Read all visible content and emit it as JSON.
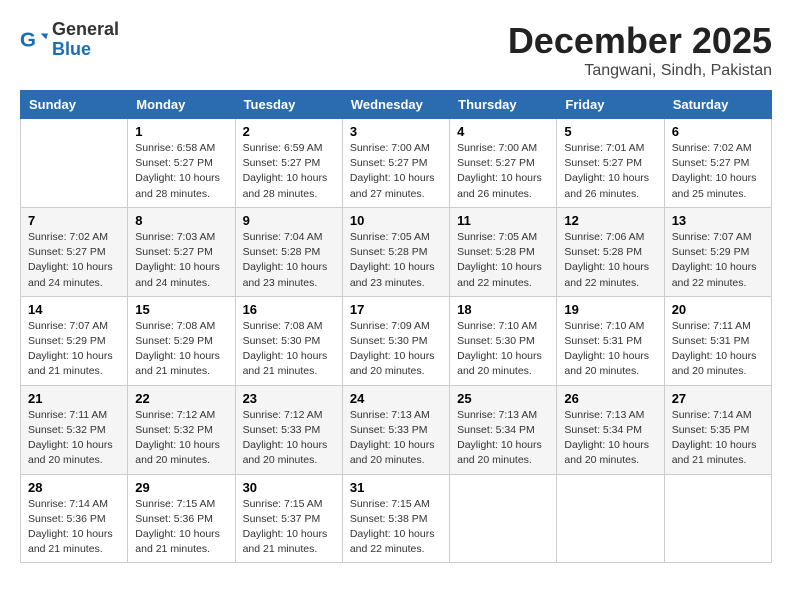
{
  "header": {
    "logo": {
      "general": "General",
      "blue": "Blue"
    },
    "month": "December 2025",
    "location": "Tangwani, Sindh, Pakistan"
  },
  "weekdays": [
    "Sunday",
    "Monday",
    "Tuesday",
    "Wednesday",
    "Thursday",
    "Friday",
    "Saturday"
  ],
  "weeks": [
    [
      {
        "day": "",
        "sunrise": "",
        "sunset": "",
        "daylight": ""
      },
      {
        "day": "1",
        "sunrise": "Sunrise: 6:58 AM",
        "sunset": "Sunset: 5:27 PM",
        "daylight": "Daylight: 10 hours and 28 minutes."
      },
      {
        "day": "2",
        "sunrise": "Sunrise: 6:59 AM",
        "sunset": "Sunset: 5:27 PM",
        "daylight": "Daylight: 10 hours and 28 minutes."
      },
      {
        "day": "3",
        "sunrise": "Sunrise: 7:00 AM",
        "sunset": "Sunset: 5:27 PM",
        "daylight": "Daylight: 10 hours and 27 minutes."
      },
      {
        "day": "4",
        "sunrise": "Sunrise: 7:00 AM",
        "sunset": "Sunset: 5:27 PM",
        "daylight": "Daylight: 10 hours and 26 minutes."
      },
      {
        "day": "5",
        "sunrise": "Sunrise: 7:01 AM",
        "sunset": "Sunset: 5:27 PM",
        "daylight": "Daylight: 10 hours and 26 minutes."
      },
      {
        "day": "6",
        "sunrise": "Sunrise: 7:02 AM",
        "sunset": "Sunset: 5:27 PM",
        "daylight": "Daylight: 10 hours and 25 minutes."
      }
    ],
    [
      {
        "day": "7",
        "sunrise": "Sunrise: 7:02 AM",
        "sunset": "Sunset: 5:27 PM",
        "daylight": "Daylight: 10 hours and 24 minutes."
      },
      {
        "day": "8",
        "sunrise": "Sunrise: 7:03 AM",
        "sunset": "Sunset: 5:27 PM",
        "daylight": "Daylight: 10 hours and 24 minutes."
      },
      {
        "day": "9",
        "sunrise": "Sunrise: 7:04 AM",
        "sunset": "Sunset: 5:28 PM",
        "daylight": "Daylight: 10 hours and 23 minutes."
      },
      {
        "day": "10",
        "sunrise": "Sunrise: 7:05 AM",
        "sunset": "Sunset: 5:28 PM",
        "daylight": "Daylight: 10 hours and 23 minutes."
      },
      {
        "day": "11",
        "sunrise": "Sunrise: 7:05 AM",
        "sunset": "Sunset: 5:28 PM",
        "daylight": "Daylight: 10 hours and 22 minutes."
      },
      {
        "day": "12",
        "sunrise": "Sunrise: 7:06 AM",
        "sunset": "Sunset: 5:28 PM",
        "daylight": "Daylight: 10 hours and 22 minutes."
      },
      {
        "day": "13",
        "sunrise": "Sunrise: 7:07 AM",
        "sunset": "Sunset: 5:29 PM",
        "daylight": "Daylight: 10 hours and 22 minutes."
      }
    ],
    [
      {
        "day": "14",
        "sunrise": "Sunrise: 7:07 AM",
        "sunset": "Sunset: 5:29 PM",
        "daylight": "Daylight: 10 hours and 21 minutes."
      },
      {
        "day": "15",
        "sunrise": "Sunrise: 7:08 AM",
        "sunset": "Sunset: 5:29 PM",
        "daylight": "Daylight: 10 hours and 21 minutes."
      },
      {
        "day": "16",
        "sunrise": "Sunrise: 7:08 AM",
        "sunset": "Sunset: 5:30 PM",
        "daylight": "Daylight: 10 hours and 21 minutes."
      },
      {
        "day": "17",
        "sunrise": "Sunrise: 7:09 AM",
        "sunset": "Sunset: 5:30 PM",
        "daylight": "Daylight: 10 hours and 20 minutes."
      },
      {
        "day": "18",
        "sunrise": "Sunrise: 7:10 AM",
        "sunset": "Sunset: 5:30 PM",
        "daylight": "Daylight: 10 hours and 20 minutes."
      },
      {
        "day": "19",
        "sunrise": "Sunrise: 7:10 AM",
        "sunset": "Sunset: 5:31 PM",
        "daylight": "Daylight: 10 hours and 20 minutes."
      },
      {
        "day": "20",
        "sunrise": "Sunrise: 7:11 AM",
        "sunset": "Sunset: 5:31 PM",
        "daylight": "Daylight: 10 hours and 20 minutes."
      }
    ],
    [
      {
        "day": "21",
        "sunrise": "Sunrise: 7:11 AM",
        "sunset": "Sunset: 5:32 PM",
        "daylight": "Daylight: 10 hours and 20 minutes."
      },
      {
        "day": "22",
        "sunrise": "Sunrise: 7:12 AM",
        "sunset": "Sunset: 5:32 PM",
        "daylight": "Daylight: 10 hours and 20 minutes."
      },
      {
        "day": "23",
        "sunrise": "Sunrise: 7:12 AM",
        "sunset": "Sunset: 5:33 PM",
        "daylight": "Daylight: 10 hours and 20 minutes."
      },
      {
        "day": "24",
        "sunrise": "Sunrise: 7:13 AM",
        "sunset": "Sunset: 5:33 PM",
        "daylight": "Daylight: 10 hours and 20 minutes."
      },
      {
        "day": "25",
        "sunrise": "Sunrise: 7:13 AM",
        "sunset": "Sunset: 5:34 PM",
        "daylight": "Daylight: 10 hours and 20 minutes."
      },
      {
        "day": "26",
        "sunrise": "Sunrise: 7:13 AM",
        "sunset": "Sunset: 5:34 PM",
        "daylight": "Daylight: 10 hours and 20 minutes."
      },
      {
        "day": "27",
        "sunrise": "Sunrise: 7:14 AM",
        "sunset": "Sunset: 5:35 PM",
        "daylight": "Daylight: 10 hours and 21 minutes."
      }
    ],
    [
      {
        "day": "28",
        "sunrise": "Sunrise: 7:14 AM",
        "sunset": "Sunset: 5:36 PM",
        "daylight": "Daylight: 10 hours and 21 minutes."
      },
      {
        "day": "29",
        "sunrise": "Sunrise: 7:15 AM",
        "sunset": "Sunset: 5:36 PM",
        "daylight": "Daylight: 10 hours and 21 minutes."
      },
      {
        "day": "30",
        "sunrise": "Sunrise: 7:15 AM",
        "sunset": "Sunset: 5:37 PM",
        "daylight": "Daylight: 10 hours and 21 minutes."
      },
      {
        "day": "31",
        "sunrise": "Sunrise: 7:15 AM",
        "sunset": "Sunset: 5:38 PM",
        "daylight": "Daylight: 10 hours and 22 minutes."
      },
      {
        "day": "",
        "sunrise": "",
        "sunset": "",
        "daylight": ""
      },
      {
        "day": "",
        "sunrise": "",
        "sunset": "",
        "daylight": ""
      },
      {
        "day": "",
        "sunrise": "",
        "sunset": "",
        "daylight": ""
      }
    ]
  ]
}
